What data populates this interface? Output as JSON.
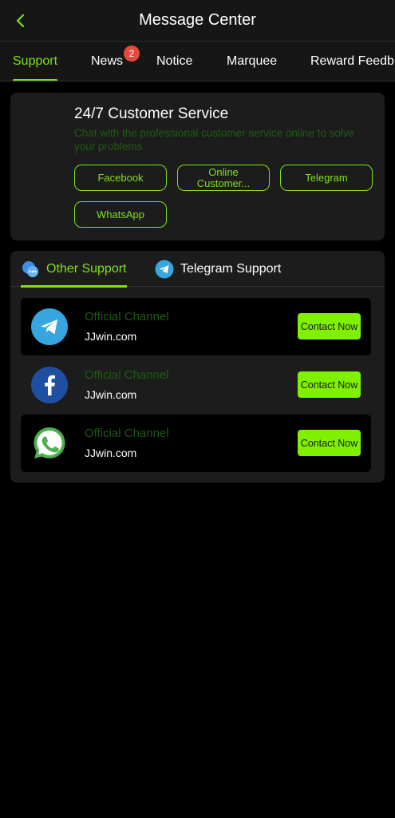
{
  "header": {
    "title": "Message Center"
  },
  "tabs": [
    {
      "label": "Support"
    },
    {
      "label": "News",
      "badge": "2"
    },
    {
      "label": "Notice"
    },
    {
      "label": "Marquee"
    },
    {
      "label": "Reward Feedb"
    }
  ],
  "customer_service": {
    "title": "24/7 Customer Service",
    "subtitle": "Chat with the professional customer service online to solve your problems.",
    "buttons": [
      {
        "label": "Facebook"
      },
      {
        "label": "Online Customer..."
      },
      {
        "label": "Telegram"
      },
      {
        "label": "WhatsApp"
      }
    ]
  },
  "support_tabs": [
    {
      "label": "Other Support"
    },
    {
      "label": "Telegram Support"
    }
  ],
  "channels": [
    {
      "icon": "telegram-icon",
      "label": "Official Channel",
      "value": "JJwin.com",
      "action": "Contact Now"
    },
    {
      "icon": "facebook-icon",
      "label": "Official Channel",
      "value": "JJwin.com",
      "action": "Contact Now"
    },
    {
      "icon": "whatsapp-icon",
      "label": "Official Channel",
      "value": "JJwin.com",
      "action": "Contact Now"
    }
  ],
  "colors": {
    "accent": "#7fe01a",
    "button": "#7ff000",
    "badge": "#e64a3c"
  }
}
